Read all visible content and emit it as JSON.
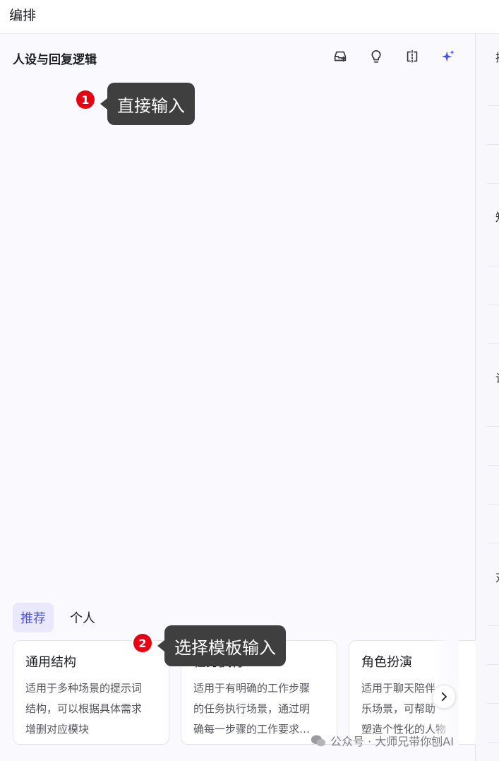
{
  "header": {
    "title": "编排"
  },
  "section": {
    "title": "人设与回复逻辑",
    "toolbar": [
      {
        "icon": "inbox-upload-icon"
      },
      {
        "icon": "lightbulb-icon"
      },
      {
        "icon": "compare-split-icon"
      },
      {
        "icon": "sparkle-icon",
        "color": "#4d53e8"
      }
    ]
  },
  "annotations": [
    {
      "number": "1",
      "text": "直接输入"
    },
    {
      "number": "2",
      "text": "选择模板输入"
    }
  ],
  "template_tabs": [
    {
      "label": "推荐",
      "active": true
    },
    {
      "label": "个人",
      "active": false
    }
  ],
  "template_cards": [
    {
      "title": "通用结构",
      "desc": [
        "适用于多种场景的提示词",
        "结构，可以根据具体需求",
        "增删对应模块"
      ]
    },
    {
      "title": "任务执行",
      "desc": [
        "适用于有明确的工作步骤",
        "的任务执行场景，通过明",
        "确每一步骤的工作要求…"
      ]
    },
    {
      "title": "角色扮演",
      "desc": [
        "适用于聊天陪伴",
        "乐场景，可帮助",
        "塑造个性化的人物"
      ]
    }
  ],
  "right_panel": {
    "glyphs": [
      "插",
      "知",
      "记",
      "对"
    ]
  },
  "watermark": {
    "text": "公众号 · 大师兄带你刨AI"
  },
  "colors": {
    "accent": "#4d53e8",
    "badge": "#e60012",
    "callout_bg": "#3f3f3f"
  }
}
